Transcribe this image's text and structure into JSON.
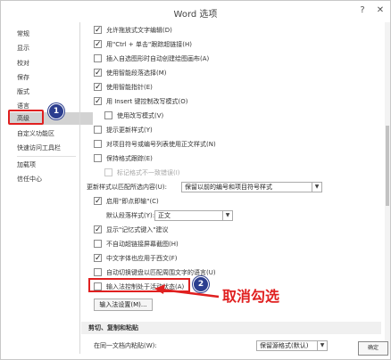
{
  "window": {
    "title": "Word 选项"
  },
  "controls": {
    "help": "?",
    "close": "✕"
  },
  "sidebar": {
    "items": [
      {
        "label": "常规"
      },
      {
        "label": "显示"
      },
      {
        "label": "校对"
      },
      {
        "label": "保存"
      },
      {
        "label": "版式"
      },
      {
        "label": "语言"
      },
      {
        "label": "高级",
        "selected": true
      },
      {
        "label": "自定义功能区"
      },
      {
        "label": "快速访问工具栏"
      },
      {
        "label": "加载项"
      },
      {
        "label": "信任中心"
      }
    ]
  },
  "badges": {
    "one": "1",
    "two": "2"
  },
  "options": {
    "drag_drop": "允许拖放式文字编辑(D)",
    "ctrl_click": "用\"Ctrl + 单击\"跟踪超链接(H)",
    "auto_canvas": "插入自选图形时自动创建绘图画布(A)",
    "smart_para": "使用智能段落选择(M)",
    "smart_cursor": "使用智能指针(E)",
    "insert_key": "用 Insert 键控制改写模式(O)",
    "overtype": "使用改写模式(V)",
    "update_prompt": "提示更新样式(Y)",
    "normal_style": "对项目符号或编号列表使用正文样式(N)",
    "keep_format": "保持格式跟踪(E)",
    "mark_inconsistent": "标记格式不一致错误(I)",
    "update_style_label": "更新样式以匹配所选内容(U):",
    "update_style_value": "保留以前的编号和项目符号样式",
    "click_type": "启用\"即点即输\"(C)",
    "default_para_label": "默认段落样式(Y):",
    "default_para_value": "正文",
    "autocomplete": "显示\"记忆式键入\"建议",
    "no_auto_link": "不自动超链接屏幕截图(H)",
    "chinese_font": "中文字体也应用于西文(F)",
    "keyboard_lang": "自动切换键盘以匹配周围文字的语言(U)",
    "ime_control": "输入法控制处于活动状态(A)",
    "ime_settings": "输入法设置(M)..."
  },
  "section": {
    "cut_copy_paste": "剪切、复制和粘贴"
  },
  "paste": {
    "same_doc_label": "在同一文档内粘贴(W):",
    "same_doc_value": "保留源格式(默认)"
  },
  "annotation": {
    "text": "取消勾选"
  },
  "footer": {
    "ok": "确定"
  },
  "colors": {
    "accent": "#e02020",
    "badge": "#2c3e8f",
    "selected_bg": "#d2d2d2"
  }
}
